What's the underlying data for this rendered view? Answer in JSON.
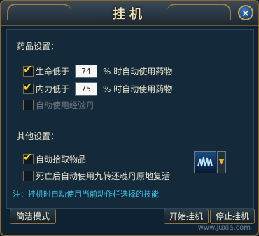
{
  "window": {
    "title": "挂机",
    "close_glyph": "✕"
  },
  "drugs": {
    "section_label": "药品设置：",
    "hp": {
      "prefix": "生命低于",
      "value": "74",
      "suffix": "% 时自动使用药物",
      "checked": true
    },
    "mp": {
      "prefix": "内力低于",
      "value": "75",
      "suffix": "% 时自动使用药物",
      "checked": true
    },
    "exp": {
      "label": "自动使用经验丹",
      "checked": false
    }
  },
  "other": {
    "section_label": "其他设置：",
    "auto_pick": {
      "label": "自动拾取物品",
      "checked": true
    },
    "revive": {
      "label": "死亡后自动使用九转还魂丹原地复活",
      "checked": false
    }
  },
  "note": "注：挂机时自动使用当前动作栏选择的技能",
  "buttons": {
    "simple_mode": "简洁模式",
    "start": "开始挂机",
    "stop": "停止挂机"
  },
  "watermark": "www.juxia.com",
  "colors": {
    "accent_gold": "#c9a253",
    "note_cyan": "#41c1e6",
    "check_yellow": "#f3d02e"
  },
  "icons": {
    "skill": "wave-skill-icon",
    "dropdown": "triangle-down-icon"
  }
}
